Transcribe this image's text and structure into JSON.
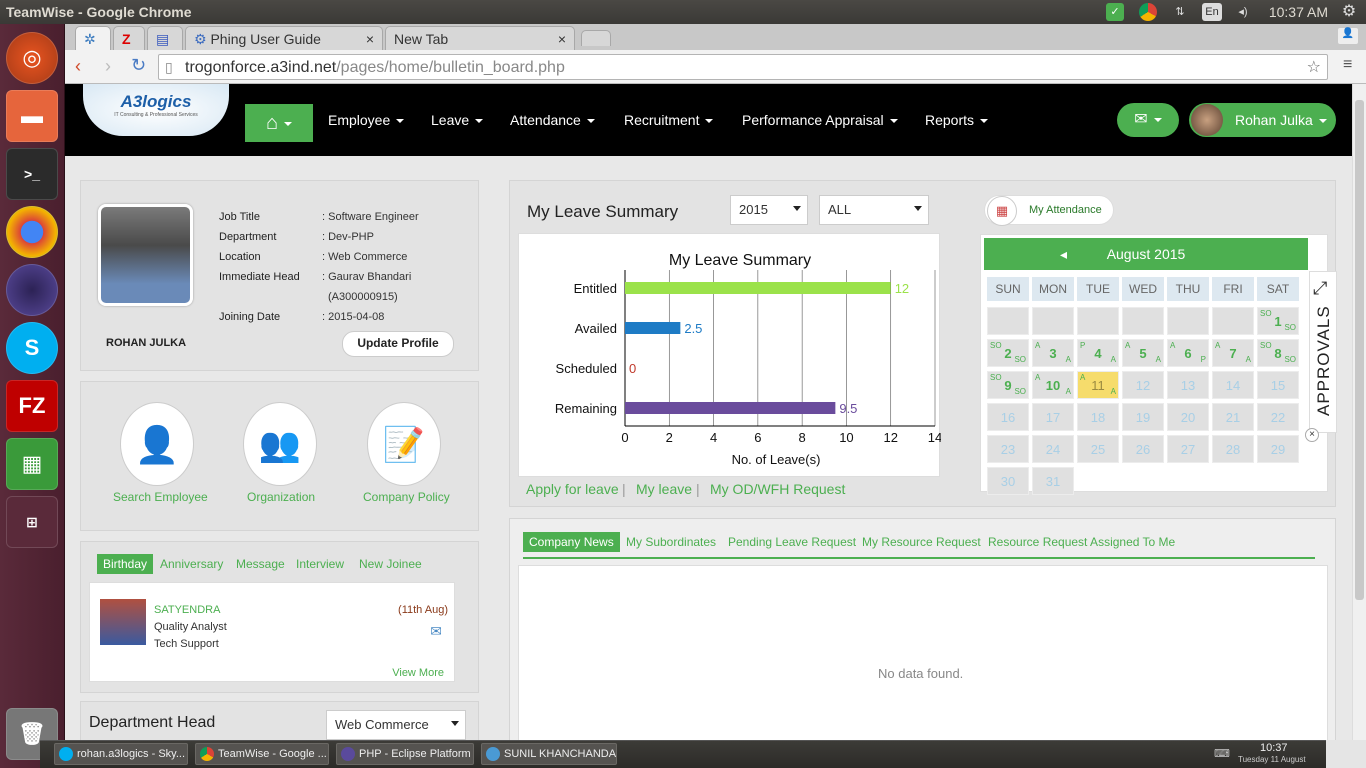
{
  "os": {
    "window_title": "TeamWise - Google Chrome",
    "time": "10:37 AM",
    "keyboard": "En"
  },
  "browser": {
    "tabs": [
      {
        "label": "Z"
      },
      {
        "label": ""
      },
      {
        "label": "Phing User Guide"
      },
      {
        "label": "New Tab"
      }
    ],
    "url_host": "trogonforce.a3ind.net",
    "url_path": "/pages/home/bulletin_board.php"
  },
  "nav": {
    "logo": "A3logics",
    "logo_sub": "IT Consulting & Professional Services",
    "items": [
      "Employee",
      "Leave",
      "Attendance",
      "Recruitment",
      "Performance Appraisal",
      "Reports"
    ],
    "user": "Rohan Julka"
  },
  "profile": {
    "fields": [
      {
        "k": "Job Title",
        "v": ": Software Engineer"
      },
      {
        "k": "Department",
        "v": ": Dev-PHP"
      },
      {
        "k": "Location",
        "v": ": Web Commerce"
      },
      {
        "k": "Immediate Head",
        "v": ": Gaurav Bhandari"
      },
      {
        "k": "",
        "v": "(A300000915)"
      },
      {
        "k": "Joining Date",
        "v": ": 2015-04-08"
      }
    ],
    "name": "ROHAN JULKA",
    "update_btn": "Update Profile"
  },
  "quick": [
    "Search Employee",
    "Organization",
    "Company Policy"
  ],
  "events": {
    "tabs": [
      "Birthday",
      "Anniversary",
      "Message",
      "Interview",
      "New Joinee"
    ],
    "person": "SATYENDRA",
    "date": "(11th Aug)",
    "role": "Quality Analyst",
    "dept": "Tech Support",
    "view_more": "View More"
  },
  "dept_head": {
    "title": "Department Head",
    "select": "Web Commerce"
  },
  "leave": {
    "title": "My Leave Summary",
    "year": "2015",
    "type": "ALL",
    "links": [
      "Apply for leave",
      "My leave",
      "My OD/WFH Request"
    ],
    "sep": "|"
  },
  "chart_data": {
    "type": "bar",
    "title": "My Leave Summary",
    "categories": [
      "Entitled",
      "Availed",
      "Scheduled",
      "Remaining"
    ],
    "values": [
      12,
      2.5,
      0,
      9.5
    ],
    "value_labels": [
      "12",
      "2.5",
      "0",
      "9.5"
    ],
    "colors": [
      "#9be24a",
      "#1e7bc5",
      "#c0392b",
      "#6a4c9c"
    ],
    "xlabel": "No. of Leave(s)",
    "xlim": [
      0,
      14
    ],
    "ticks": [
      "0",
      "2",
      "4",
      "6",
      "8",
      "10",
      "12",
      "14"
    ],
    "orientation": "horizontal"
  },
  "attendance": {
    "button": "My Attendance",
    "month": "August 2015",
    "days": [
      "SUN",
      "MON",
      "TUE",
      "WED",
      "THU",
      "FRI",
      "SAT"
    ],
    "approvals": "APPROVALS",
    "weeks": [
      [
        "",
        "",
        "",
        "",
        "",
        "",
        {
          "d": "1",
          "tl": "SO",
          "br": "SO"
        }
      ],
      [
        {
          "d": "2",
          "tl": "SO",
          "br": "SO"
        },
        {
          "d": "3",
          "tl": "A",
          "br": "A"
        },
        {
          "d": "4",
          "tl": "P",
          "br": "A"
        },
        {
          "d": "5",
          "tl": "A",
          "br": "A"
        },
        {
          "d": "6",
          "tl": "A",
          "br": "P"
        },
        {
          "d": "7",
          "tl": "A",
          "br": "A"
        },
        {
          "d": "8",
          "tl": "SO",
          "br": "SO"
        }
      ],
      [
        {
          "d": "9",
          "tl": "SO",
          "br": "SO"
        },
        {
          "d": "10",
          "tl": "A",
          "br": "A"
        },
        {
          "d": "11",
          "tl": "A",
          "br": "A",
          "today": true
        },
        {
          "d": "12",
          "f": true
        },
        {
          "d": "13",
          "f": true
        },
        {
          "d": "14",
          "f": true
        },
        {
          "d": "15",
          "f": true
        }
      ],
      [
        {
          "d": "16",
          "f": true
        },
        {
          "d": "17",
          "f": true
        },
        {
          "d": "18",
          "f": true
        },
        {
          "d": "19",
          "f": true
        },
        {
          "d": "20",
          "f": true
        },
        {
          "d": "21",
          "f": true
        },
        {
          "d": "22",
          "f": true
        }
      ],
      [
        {
          "d": "23",
          "f": true
        },
        {
          "d": "24",
          "f": true
        },
        {
          "d": "25",
          "f": true
        },
        {
          "d": "26",
          "f": true
        },
        {
          "d": "27",
          "f": true
        },
        {
          "d": "28",
          "f": true
        },
        {
          "d": "29",
          "f": true
        }
      ],
      [
        {
          "d": "30",
          "f": true
        },
        {
          "d": "31",
          "f": true
        }
      ]
    ]
  },
  "news": {
    "tabs": [
      "Company News",
      "My Subordinates",
      "Pending Leave Request",
      "My Resource Request",
      "Resource Request Assigned To Me"
    ],
    "empty": "No data found."
  },
  "taskbar": {
    "items": [
      "rohan.a3logics - Sky...",
      "TeamWise - Google ...",
      "PHP - Eclipse Platform",
      "SUNIL KHANCHANDA..."
    ],
    "time": "10:37",
    "date": "Tuesday 11 August"
  }
}
